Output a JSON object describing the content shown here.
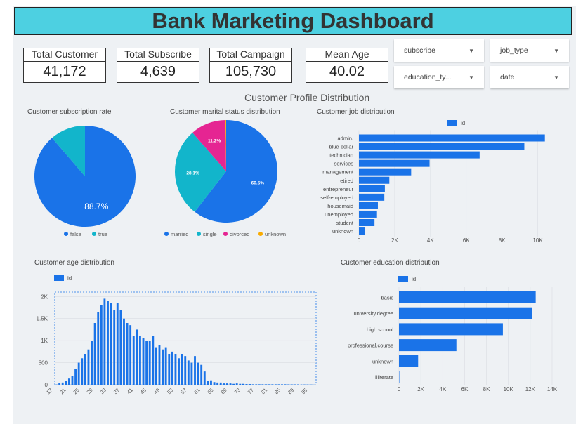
{
  "dashboard": {
    "title": "Bank Marketing Dashboard",
    "section_title": "Customer Profile Distribution"
  },
  "kpis": [
    {
      "label": "Total Customer",
      "value": "41,172"
    },
    {
      "label": "Total Subscribe",
      "value": "4,639"
    },
    {
      "label": "Total Campaign",
      "value": "105,730"
    },
    {
      "label": "Mean Age",
      "value": "40.02"
    }
  ],
  "filters": [
    {
      "label": "subscribe"
    },
    {
      "label": "job_type"
    },
    {
      "label": "education_ty..."
    },
    {
      "label": "date"
    }
  ],
  "colors": {
    "blue": "#1a73e8",
    "teal": "#12b5cb",
    "pink": "#e52592",
    "orange": "#f9ab00"
  },
  "chart_data": [
    {
      "id": "subscription",
      "type": "pie",
      "title": "Customer subscription rate",
      "categories": [
        "false",
        "true"
      ],
      "values": [
        88.7,
        11.3
      ],
      "slice_labels": [
        "88.7%",
        ""
      ],
      "colors": [
        "#1a73e8",
        "#12b5cb"
      ],
      "legend": "bottom"
    },
    {
      "id": "marital",
      "type": "pie",
      "title": "Customer marital status distribution",
      "categories": [
        "married",
        "single",
        "divorced",
        "unknown"
      ],
      "values": [
        60.5,
        28.1,
        11.2,
        0.2
      ],
      "slice_labels": [
        "60.5%",
        "28.1%",
        "11.2%",
        ""
      ],
      "colors": [
        "#1a73e8",
        "#12b5cb",
        "#e52592",
        "#f9ab00"
      ],
      "legend": "bottom"
    },
    {
      "id": "job",
      "type": "bar",
      "orientation": "horizontal",
      "title": "Customer job distribution",
      "legend_label": "id",
      "legend": "top",
      "categories": [
        "admin.",
        "blue-collar",
        "technician",
        "services",
        "management",
        "retired",
        "entrepreneur",
        "self-employed",
        "housemaid",
        "unemployed",
        "student",
        "unknown"
      ],
      "values": [
        10400,
        9250,
        6750,
        3950,
        2920,
        1700,
        1450,
        1420,
        1060,
        1010,
        870,
        330
      ],
      "xlim": [
        0,
        11000
      ],
      "ticks": [
        0,
        2000,
        4000,
        6000,
        8000,
        10000
      ],
      "tick_labels": [
        "0",
        "2K",
        "4K",
        "6K",
        "8K",
        "10K"
      ]
    },
    {
      "id": "age",
      "type": "bar",
      "title": "Customer age distribution",
      "legend_label": "id",
      "legend": "top",
      "x_start": 17,
      "values": [
        5,
        35,
        50,
        80,
        140,
        200,
        350,
        500,
        600,
        700,
        800,
        1000,
        1400,
        1650,
        1800,
        1950,
        1900,
        1850,
        1700,
        1850,
        1700,
        1500,
        1400,
        1350,
        1100,
        1250,
        1100,
        1050,
        1000,
        1000,
        1100,
        850,
        900,
        800,
        850,
        700,
        750,
        700,
        600,
        700,
        650,
        550,
        500,
        650,
        500,
        450,
        300,
        80,
        100,
        60,
        50,
        50,
        30,
        30,
        30,
        20,
        30,
        20,
        20,
        15,
        15,
        10,
        10,
        10,
        10,
        10,
        10,
        10,
        10,
        10,
        10,
        10,
        8,
        8,
        8,
        8,
        5,
        5,
        5,
        5,
        3
      ],
      "ylim": [
        0,
        2100
      ],
      "yticks": [
        0,
        500,
        1000,
        1500,
        2000
      ],
      "ytick_labels": [
        "0",
        "500",
        "1K",
        "1.5K",
        "2K"
      ],
      "xtick_labels": [
        "17",
        "21",
        "25",
        "29",
        "33",
        "37",
        "41",
        "45",
        "49",
        "53",
        "57",
        "61",
        "65",
        "69",
        "73",
        "77",
        "81",
        "85",
        "89",
        "95"
      ]
    },
    {
      "id": "education",
      "type": "bar",
      "orientation": "horizontal",
      "title": "Customer education distribution",
      "legend_label": "id",
      "legend": "top",
      "categories": [
        "basic",
        "university.degree",
        "high.school",
        "professional.course",
        "unknown",
        "illiterate"
      ],
      "values": [
        12500,
        12200,
        9500,
        5250,
        1750,
        20
      ],
      "xlim": [
        0,
        14000
      ],
      "ticks": [
        0,
        2000,
        4000,
        6000,
        8000,
        10000,
        12000,
        14000
      ],
      "tick_labels": [
        "0",
        "2K",
        "4K",
        "6K",
        "8K",
        "10K",
        "12K",
        "14K"
      ]
    }
  ]
}
